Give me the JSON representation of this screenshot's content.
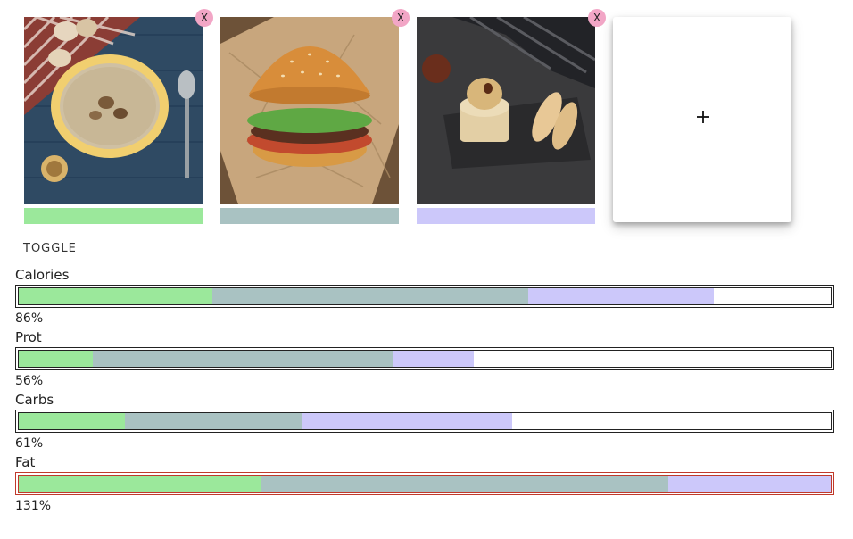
{
  "foods": [
    {
      "name": "mushroom-soup",
      "color": "#9be89b",
      "close_label": "X"
    },
    {
      "name": "burger",
      "color": "#a9c2c2",
      "close_label": "X"
    },
    {
      "name": "tiramisu",
      "color": "#ccc8fa",
      "close_label": "X"
    }
  ],
  "add_card": {
    "icon": "plus-icon"
  },
  "toggle_label": "TOGGLE",
  "metrics": [
    {
      "label": "Calories",
      "percent": "86%",
      "contributions": [
        0.239,
        0.389,
        0.228
      ]
    },
    {
      "label": "Prot",
      "percent": "56%",
      "contributions": [
        0.091,
        0.37,
        0.099
      ]
    },
    {
      "label": "Carbs",
      "percent": "61%",
      "contributions": [
        0.131,
        0.218,
        0.259
      ]
    },
    {
      "label": "Fat",
      "percent": "131%",
      "contributions": [
        0.392,
        0.656,
        0.262
      ]
    }
  ]
}
